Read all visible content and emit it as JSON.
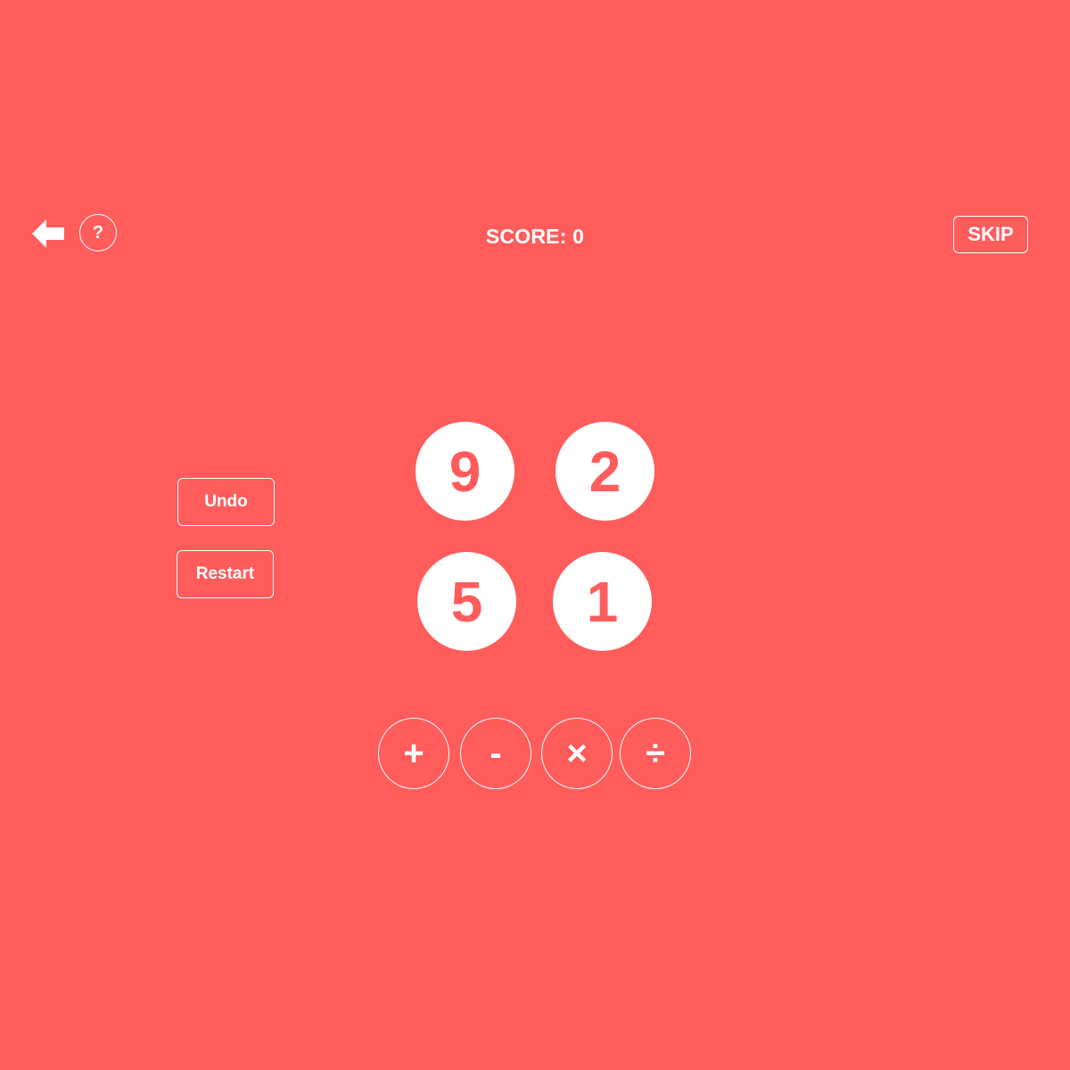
{
  "header": {
    "back_icon": "back-arrow-icon",
    "help_label": "?",
    "score_label": "SCORE:",
    "score_value": "0",
    "skip_label": "SKIP"
  },
  "controls": {
    "undo_label": "Undo",
    "restart_label": "Restart"
  },
  "numbers": [
    "9",
    "2",
    "5",
    "1"
  ],
  "operators": [
    "+",
    "-",
    "×",
    "÷"
  ],
  "colors": {
    "background": "#ff5c5c",
    "foreground": "#ffffff"
  }
}
